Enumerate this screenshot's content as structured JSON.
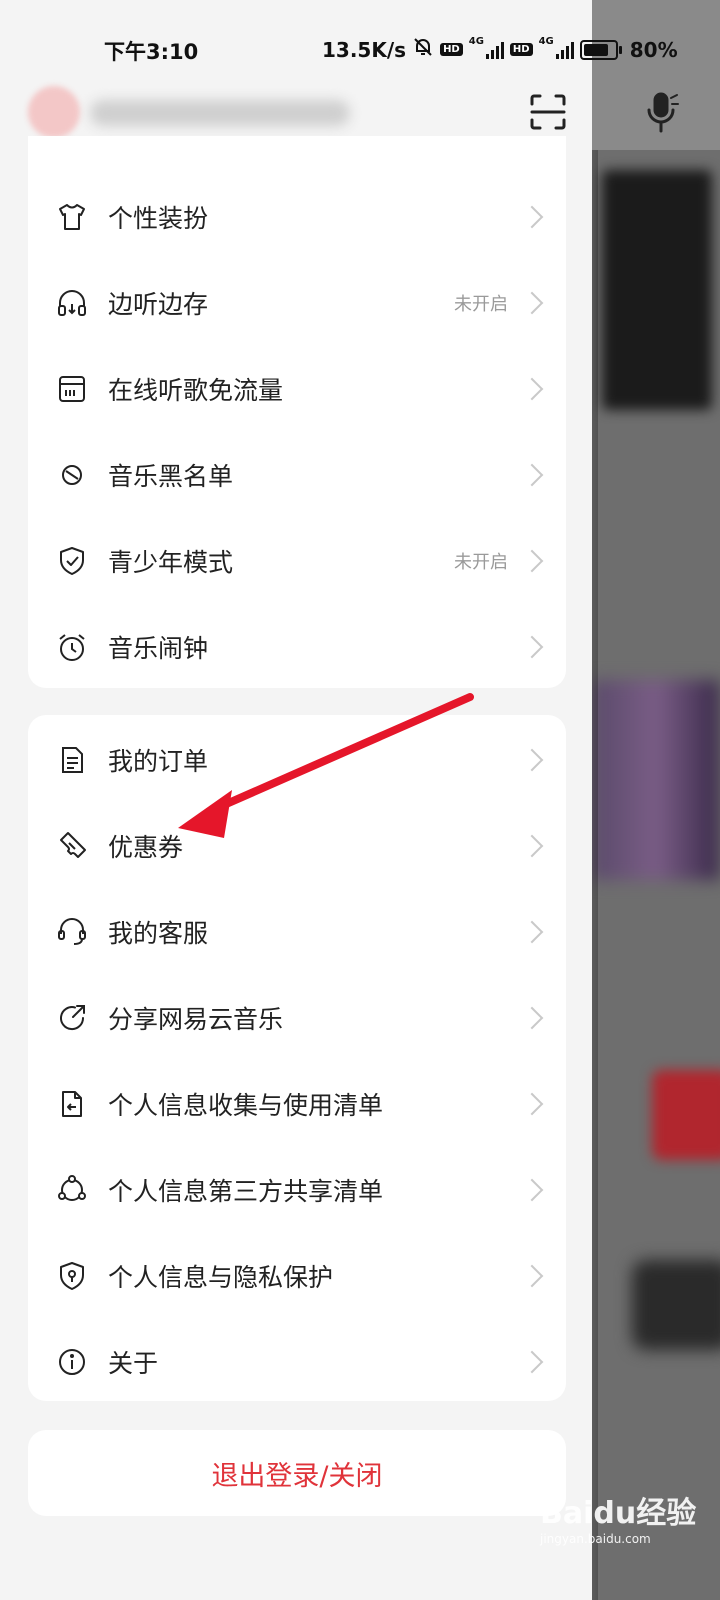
{
  "status_bar": {
    "time": "下午3:10",
    "net_speed": "13.5K/s",
    "hd1": "HD",
    "hd2": "HD",
    "net1": "4G",
    "net2": "4G",
    "battery": "80%"
  },
  "header": {
    "scan_icon": "scan-icon",
    "mic_icon": "mic-icon"
  },
  "settings": {
    "items": [
      {
        "label": "个性装扮",
        "status": "",
        "icon": "tshirt-icon"
      },
      {
        "label": "边听边存",
        "status": "未开启",
        "icon": "headphones-icon"
      },
      {
        "label": "在线听歌免流量",
        "status": "",
        "icon": "sim-card-icon"
      },
      {
        "label": "音乐黑名单",
        "status": "",
        "icon": "block-icon"
      },
      {
        "label": "青少年模式",
        "status": "未开启",
        "icon": "shield-check-icon"
      },
      {
        "label": "音乐闹钟",
        "status": "",
        "icon": "alarm-clock-icon"
      }
    ]
  },
  "more": {
    "items": [
      {
        "label": "我的订单",
        "icon": "order-icon"
      },
      {
        "label": "优惠券",
        "icon": "coupon-icon"
      },
      {
        "label": "我的客服",
        "icon": "customer-service-icon"
      },
      {
        "label": "分享网易云音乐",
        "icon": "share-icon"
      },
      {
        "label": "个人信息收集与使用清单",
        "icon": "document-return-icon"
      },
      {
        "label": "个人信息第三方共享清单",
        "icon": "share-network-icon"
      },
      {
        "label": "个人信息与隐私保护",
        "icon": "privacy-shield-icon"
      },
      {
        "label": "关于",
        "icon": "info-icon"
      }
    ]
  },
  "logout": {
    "label": "退出登录/关闭",
    "color": "#e0333a"
  },
  "watermark": {
    "brand": "Baidu经验",
    "url": "jingyan.baidu.com"
  }
}
